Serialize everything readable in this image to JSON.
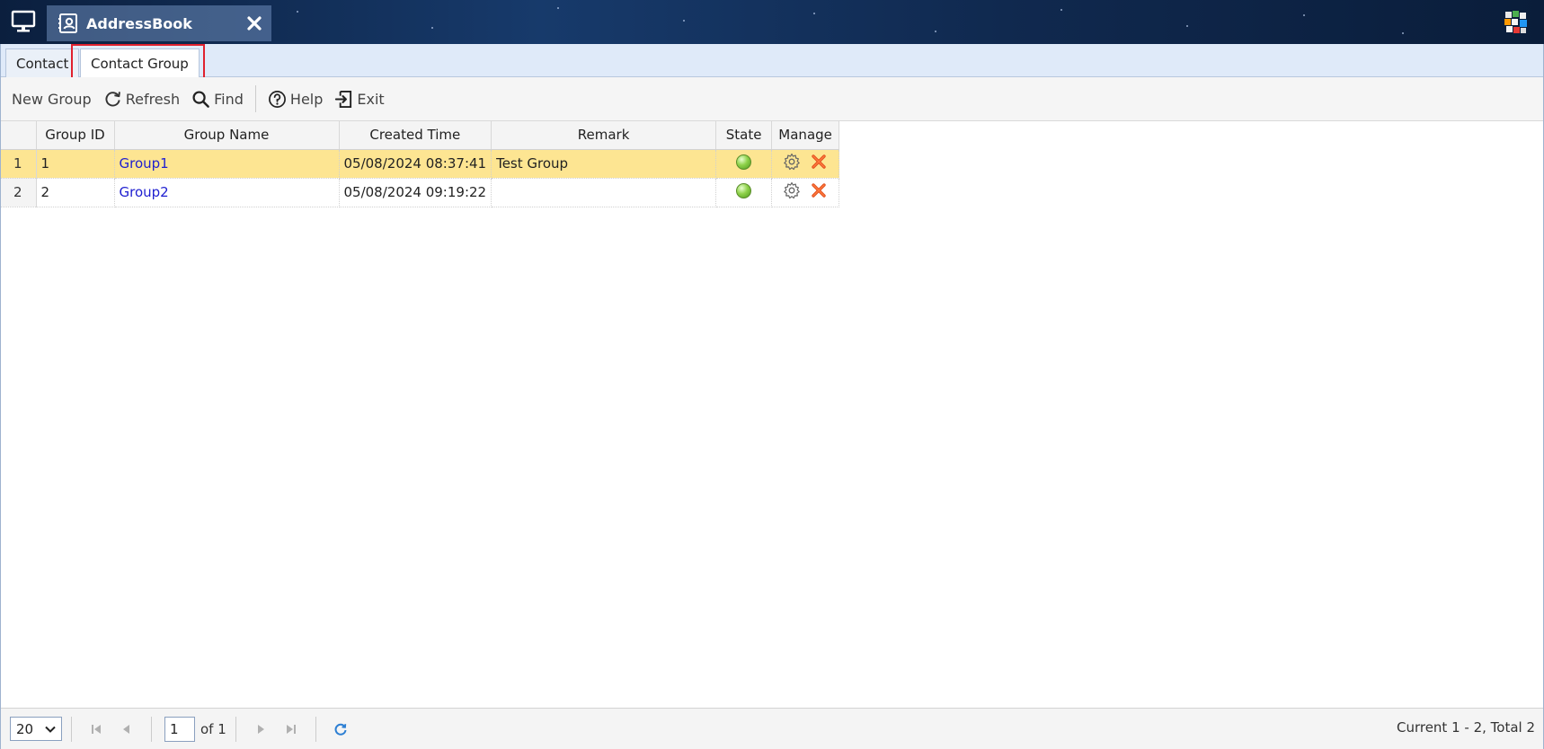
{
  "window": {
    "title": "AddressBook"
  },
  "tabs": [
    {
      "label": "Contact",
      "active": false
    },
    {
      "label": "Contact Group",
      "active": true
    }
  ],
  "toolbar": {
    "new_group": "New Group",
    "refresh": "Refresh",
    "find": "Find",
    "help": "Help",
    "exit": "Exit"
  },
  "grid": {
    "columns": [
      "Group ID",
      "Group Name",
      "Created Time",
      "Remark",
      "State",
      "Manage"
    ],
    "rows": [
      {
        "num": "1",
        "id": "1",
        "name": "Group1",
        "created": "05/08/2024 08:37:41",
        "remark": "Test Group",
        "state": "active",
        "selected": true
      },
      {
        "num": "2",
        "id": "2",
        "name": "Group2",
        "created": "05/08/2024 09:19:22",
        "remark": "",
        "state": "active",
        "selected": false
      }
    ]
  },
  "pagination": {
    "page_size": "20",
    "current_page": "1",
    "of_pages": "of 1",
    "info": "Current 1 - 2, Total 2"
  },
  "colors": {
    "selected_row": "#fde592",
    "link": "#2020d0",
    "highlight_box": "#e0212e",
    "tabstrip": "#dfeaf9"
  },
  "icons": {
    "desktop": "monitor-icon",
    "app": "address-book-icon",
    "close": "close-icon",
    "refresh": "refresh-icon",
    "find": "search-icon",
    "help": "help-icon",
    "exit": "exit-icon",
    "manage_settings": "gear-icon",
    "manage_delete": "delete-icon"
  }
}
